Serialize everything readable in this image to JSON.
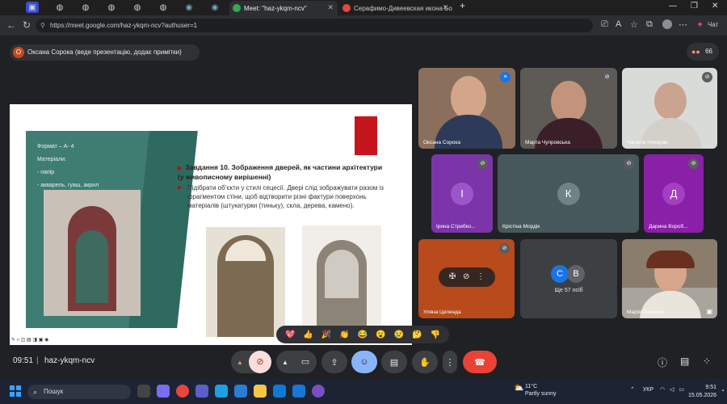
{
  "browser": {
    "tabs": [
      {
        "label": "Meet: \"haz-ykqm-ncv\"",
        "active": true
      },
      {
        "label": "Серафимо-Дивеевская икона Бож...",
        "active": false
      }
    ],
    "url": "https://meet.google.com/haz-ykqm-ncv?authuser=1",
    "chat_label": "Чат"
  },
  "meet": {
    "presenter_label": "Оксана Сорока (веде презентацію, додає примітки)",
    "presenter_initial": "О",
    "participant_count": "66",
    "meeting_time": "09:51",
    "meeting_code": "haz-ykqm-ncv",
    "reactions": [
      "💖",
      "👍",
      "🎉",
      "👏",
      "😂",
      "😮",
      "😢",
      "🤔",
      "👎"
    ],
    "tiles": [
      {
        "name": "Оксана Сорока"
      },
      {
        "name": "Марта Чупровська"
      },
      {
        "name": "Наталія Никорак"
      },
      {
        "name": "Ірина Стребко...",
        "initial": "І"
      },
      {
        "name": "Крістіна Мордік",
        "initial": "К"
      },
      {
        "name": "Дарина Вороб...",
        "initial": "Д"
      },
      {
        "name": "Уляна Цепенда"
      },
      {
        "name": "Ще 57 осіб",
        "initials": [
          "С",
          "В"
        ]
      },
      {
        "name": "Марія Пазинюк"
      }
    ]
  },
  "slide": {
    "format_lines": [
      "Формат – А- 4",
      "Матеріали:",
      "- папір",
      "- акварель, гуаш, акрил"
    ],
    "task_title": "Завдання 10. Зображення дверей, як частини архітектури (у живописному вирішенні)",
    "task_desc": "Підібрати об’єкти у стилі сецесії. Двері слід зображувати разом із фрагментом стіни, щоб відтворити різні фактури поверхонь матеріалів (штукатурки (тиньку), скла, дерева, камено)."
  },
  "taskbar": {
    "search_label": "Пошук",
    "weather_temp": "11°C",
    "weather_desc": "Partly sunny",
    "lang": "УКР",
    "time": "9:51",
    "date": "15.05.2026"
  },
  "colors": {
    "meet_bg": "#202124",
    "end_call": "#ea4335",
    "reactions_active": "#8ab4f8",
    "slide_green": "#3f7d73",
    "slide_red": "#c4161c"
  }
}
